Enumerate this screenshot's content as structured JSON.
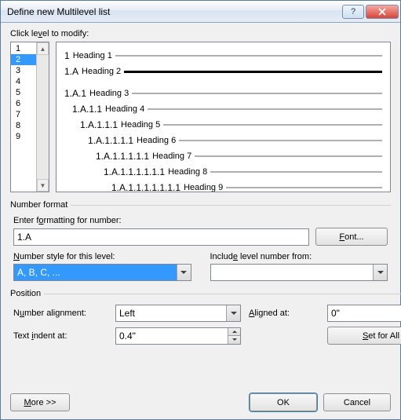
{
  "title": "Define new Multilevel list",
  "click_level_label": "Click level to modify:",
  "levels": [
    "1",
    "2",
    "3",
    "4",
    "5",
    "6",
    "7",
    "8",
    "9"
  ],
  "selected_level_index": 1,
  "preview": [
    {
      "indent": 0,
      "num": "1",
      "head": "Heading 1",
      "bold": false
    },
    {
      "indent": 0,
      "num": "1.A",
      "head": "Heading 2",
      "bold": true
    },
    {
      "indent": 0,
      "num": "",
      "head": "",
      "spacer": true
    },
    {
      "indent": 0,
      "num": "1.A.1",
      "head": "Heading 3",
      "bold": false
    },
    {
      "indent": 1,
      "num": "1.A.1.1",
      "head": "Heading 4",
      "bold": false
    },
    {
      "indent": 2,
      "num": "1.A.1.1.1",
      "head": "Heading 5",
      "bold": false
    },
    {
      "indent": 3,
      "num": "1.A.1.1.1.1",
      "head": "Heading 6",
      "bold": false
    },
    {
      "indent": 4,
      "num": "1.A.1.1.1.1.1",
      "head": "Heading 7",
      "bold": false
    },
    {
      "indent": 5,
      "num": "1.A.1.1.1.1.1.1",
      "head": "Heading 8",
      "bold": false
    },
    {
      "indent": 6,
      "num": "1.A.1.1.1.1.1.1.1",
      "head": "Heading 9",
      "bold": false
    }
  ],
  "number_format": {
    "legend": "Number format",
    "enter_label": "Enter formatting for number:",
    "enter_value": "1.A",
    "font_btn": "Font...",
    "style_label": "Number style for this level:",
    "style_value": "A, B, C, ...",
    "include_label": "Include level number from:",
    "include_value": ""
  },
  "position": {
    "legend": "Position",
    "align_label": "Number alignment:",
    "align_value": "Left",
    "aligned_at_label": "Aligned at:",
    "aligned_at_value": "0\"",
    "indent_label": "Text indent at:",
    "indent_value": "0.4\"",
    "set_all_btn": "Set for All Levels..."
  },
  "footer": {
    "more": "More >>",
    "ok": "OK",
    "cancel": "Cancel"
  }
}
